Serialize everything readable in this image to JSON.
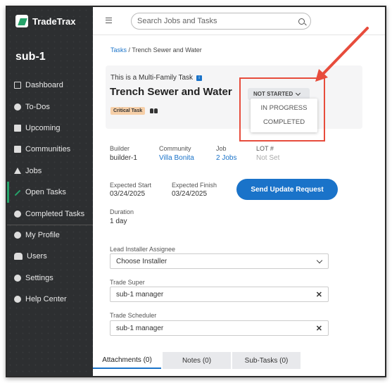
{
  "app": {
    "name": "TradeTrax",
    "org": "sub-1"
  },
  "sidebar": {
    "items": [
      {
        "label": "Dashboard",
        "icon": "dashboard-icon"
      },
      {
        "label": "To-Dos",
        "icon": "check-circle-icon"
      },
      {
        "label": "Upcoming",
        "icon": "clipboard-icon"
      },
      {
        "label": "Communities",
        "icon": "building-icon"
      },
      {
        "label": "Jobs",
        "icon": "home-icon"
      },
      {
        "label": "Open Tasks",
        "icon": "wrench-icon",
        "active": true
      },
      {
        "label": "Completed Tasks",
        "icon": "check-circle-icon"
      },
      {
        "label": "My Profile",
        "icon": "user-icon"
      },
      {
        "label": "Users",
        "icon": "users-icon"
      },
      {
        "label": "Settings",
        "icon": "gear-icon"
      },
      {
        "label": "Help Center",
        "icon": "help-icon"
      }
    ]
  },
  "search": {
    "placeholder": "Search Jobs and Tasks"
  },
  "breadcrumb": {
    "parent": "Tasks",
    "current": "Trench Sewer and Water"
  },
  "task": {
    "subtitle": "This is a Multi-Family Task",
    "title": "Trench Sewer and Water",
    "status": "NOT STARTED",
    "status_options": [
      "IN PROGRESS",
      "COMPLETED"
    ],
    "badge": "Critical Task"
  },
  "details": {
    "builder_label": "Builder",
    "builder": "builder-1",
    "community_label": "Community",
    "community": "Villa Bonita",
    "job_label": "Job",
    "job": "2 Jobs",
    "lot_label": "LOT #",
    "lot": "Not Set",
    "start_label": "Expected Start",
    "start": "03/24/2025",
    "finish_label": "Expected Finish",
    "finish": "03/24/2025",
    "duration_label": "Duration",
    "duration": "1 day"
  },
  "actions": {
    "update_request": "Send Update Request"
  },
  "assignees": {
    "installer_label": "Lead Installer Assignee",
    "installer_placeholder": "Choose Installer",
    "super_label": "Trade Super",
    "super": "sub-1 manager",
    "scheduler_label": "Trade Scheduler",
    "scheduler": "sub-1 manager"
  },
  "tabs": [
    "Attachments (0)",
    "Notes (0)",
    "Sub-Tasks (0)"
  ],
  "colors": {
    "accent": "#1a73c9",
    "sidebar_bg": "#2d2f31",
    "brand_green": "#26a36a",
    "callout": "#e74c3c"
  }
}
